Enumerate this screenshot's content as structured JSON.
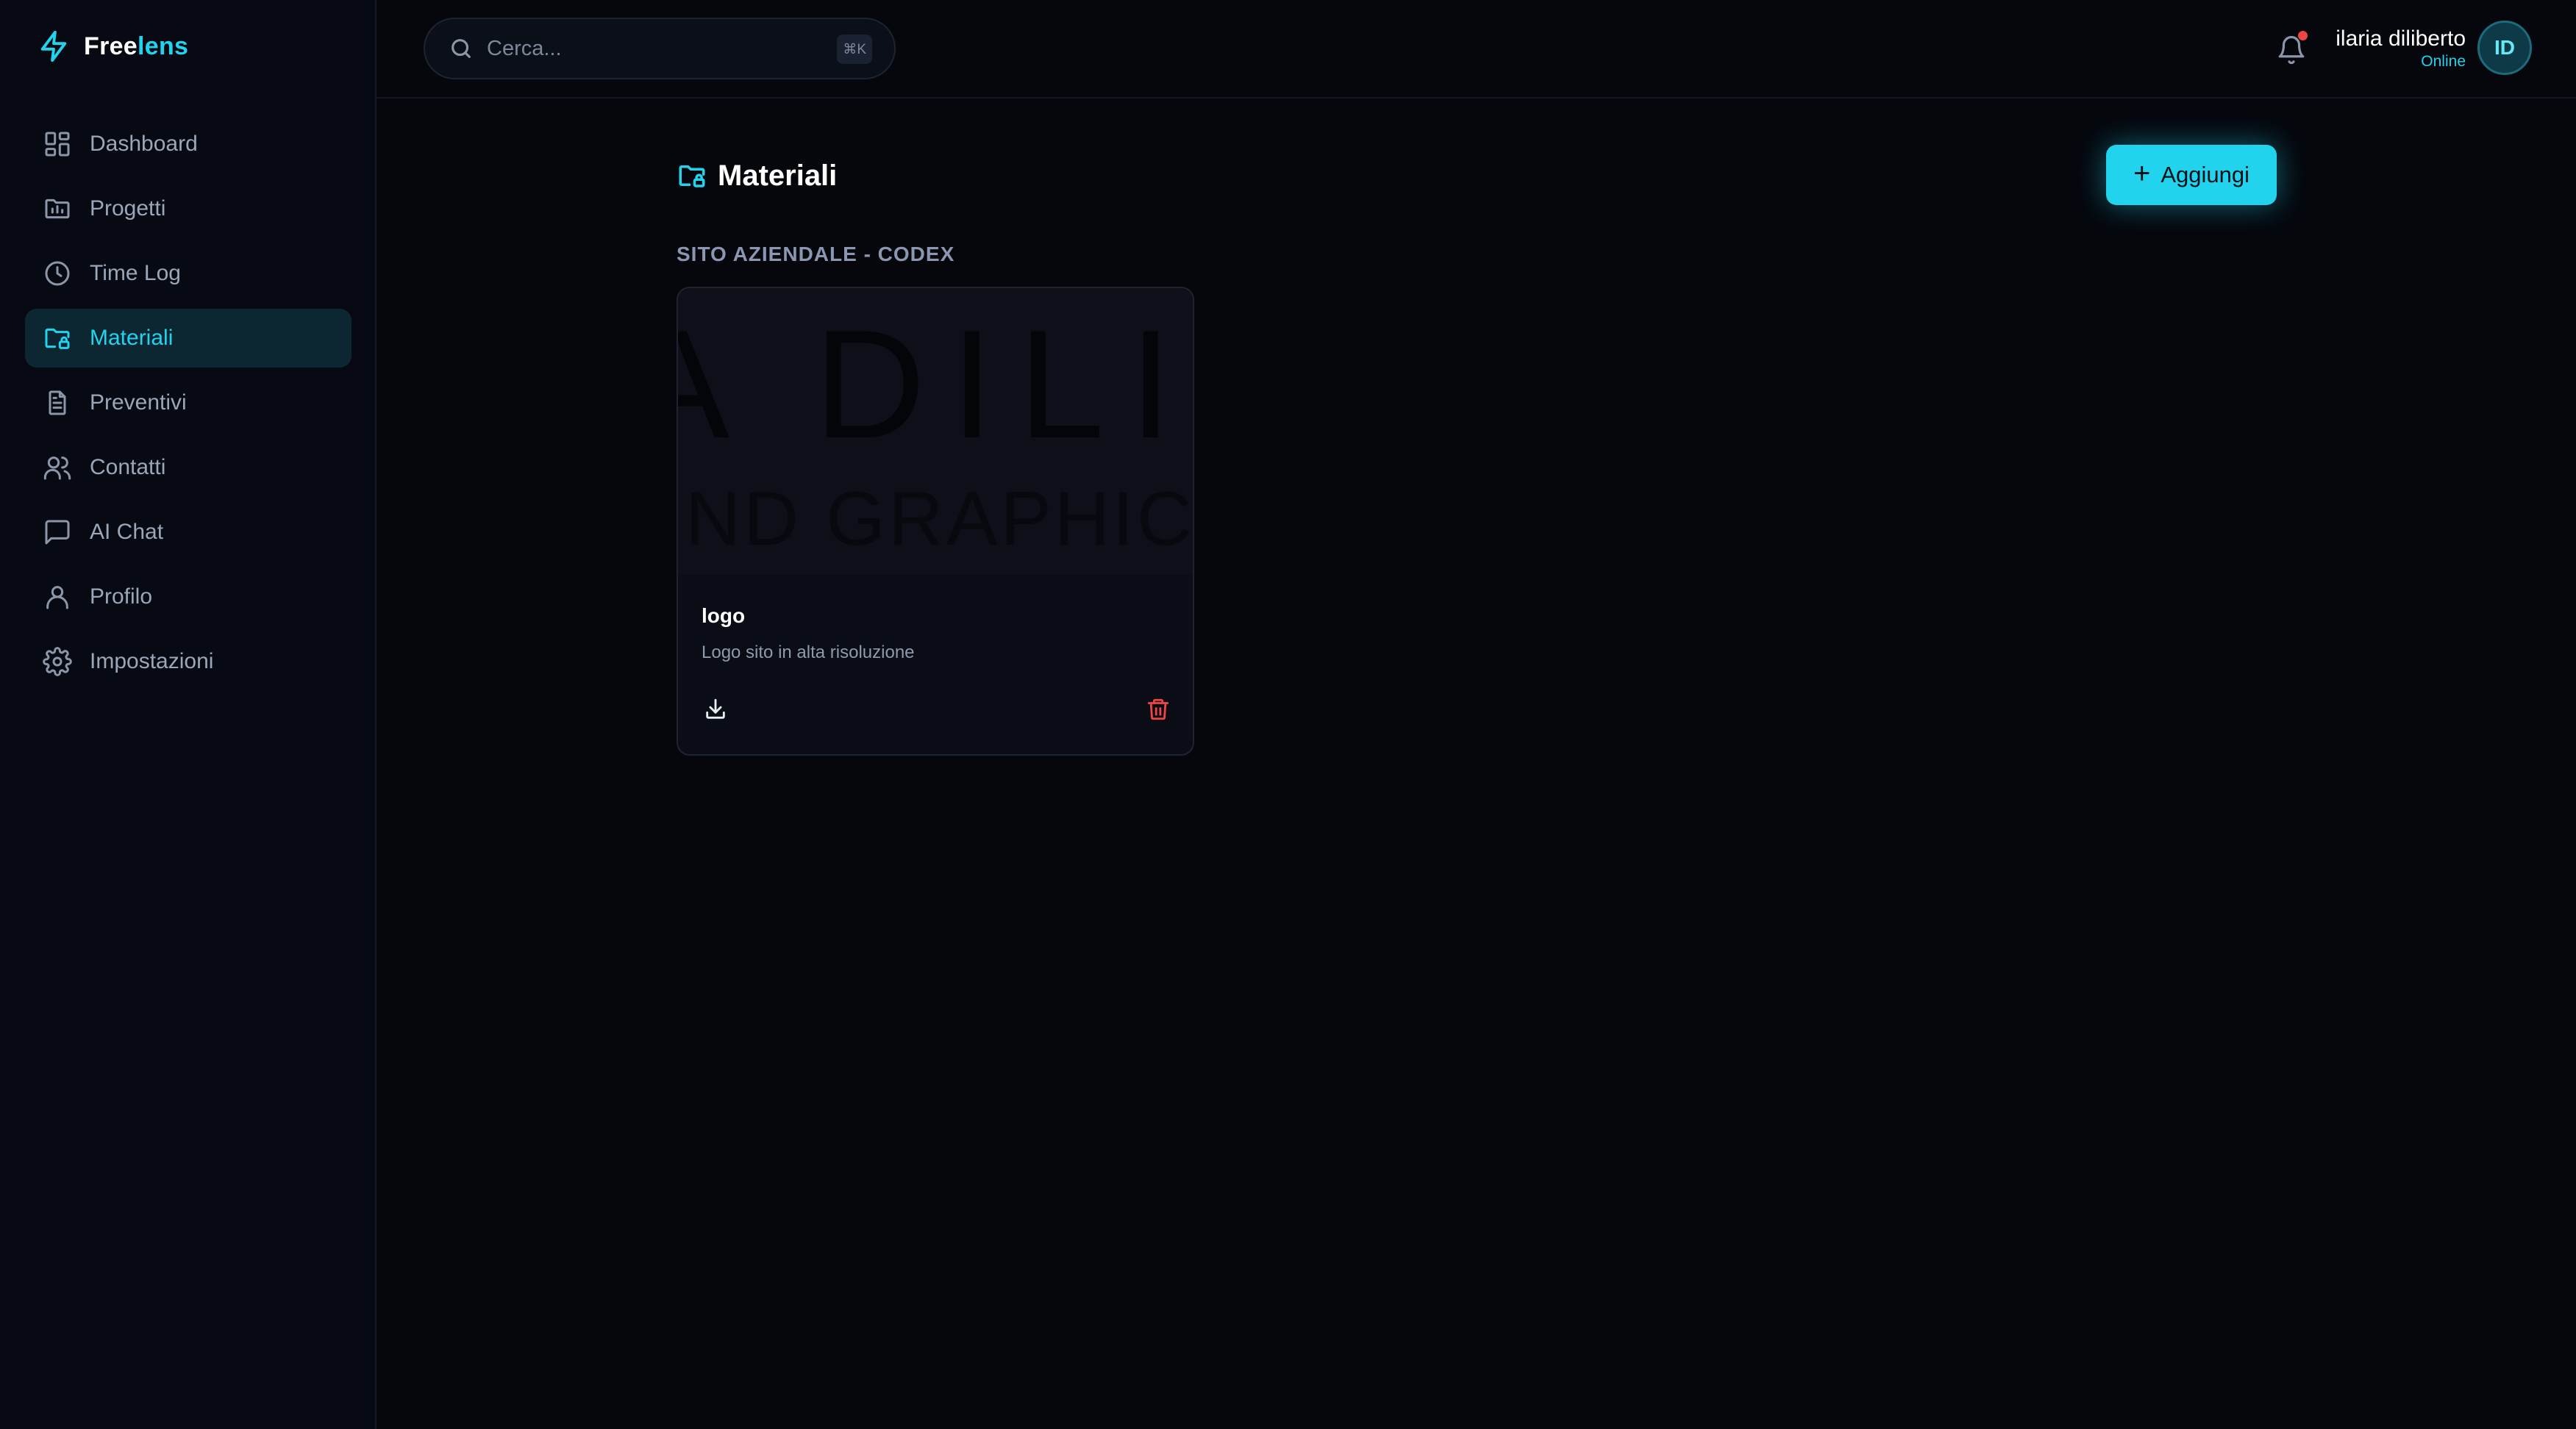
{
  "brand": {
    "part1": "Free",
    "part2": "lens",
    "icon": "lightning-icon"
  },
  "sidebar": {
    "items": [
      {
        "label": "Dashboard",
        "icon": "dashboard-grid-icon",
        "active": false
      },
      {
        "label": "Progetti",
        "icon": "folder-chart-icon",
        "active": false
      },
      {
        "label": "Time Log",
        "icon": "clock-icon",
        "active": false
      },
      {
        "label": "Materiali",
        "icon": "folder-lock-icon",
        "active": true
      },
      {
        "label": "Preventivi",
        "icon": "document-icon",
        "active": false
      },
      {
        "label": "Contatti",
        "icon": "users-icon",
        "active": false
      },
      {
        "label": "AI Chat",
        "icon": "chat-bubble-icon",
        "active": false
      },
      {
        "label": "Profilo",
        "icon": "user-icon",
        "active": false
      },
      {
        "label": "Impostazioni",
        "icon": "gear-icon",
        "active": false
      }
    ]
  },
  "search": {
    "placeholder": "Cerca...",
    "shortcut": "⌘K"
  },
  "notifications": {
    "has_unread": true
  },
  "user": {
    "name": "ilaria diliberto",
    "status": "Online",
    "initials": "ID"
  },
  "page": {
    "title": "Materiali",
    "add_label": "Aggiungi",
    "section_label": "SITO AZIENDALE - CODEX"
  },
  "materials": [
    {
      "preview_text_1": "A DILI",
      "preview_text_2": "ND GRAPHIC D",
      "title": "logo",
      "description": "Logo sito in alta risoluzione"
    }
  ],
  "colors": {
    "accent": "#22d3ee",
    "background": "#05070d",
    "sidebar": "#070a12",
    "danger": "#ef4444"
  }
}
